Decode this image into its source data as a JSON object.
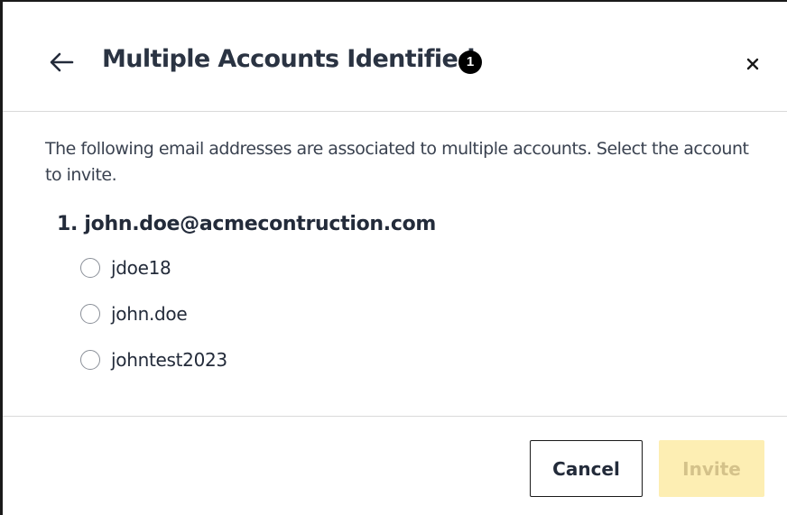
{
  "dialog": {
    "title": "Multiple Accounts Identified",
    "count_badge": "1",
    "back_icon": "arrow-left-icon",
    "close_icon": "close-icon",
    "description": "The following email addresses are associated to multiple accounts. Select the account to invite.",
    "email_heading": "1. john.doe@acmecontruction.com",
    "options": [
      {
        "label": "jdoe18",
        "selected": false
      },
      {
        "label": "john.doe",
        "selected": false
      },
      {
        "label": "johntest2023",
        "selected": false
      }
    ],
    "buttons": {
      "cancel_label": "Cancel",
      "invite_label": "Invite",
      "invite_disabled": true
    }
  },
  "colors": {
    "primary_disabled_bg": "#fdeeb3",
    "primary_disabled_text": "#d4c28a",
    "text": "#232b3a",
    "divider": "#d9d9d9"
  }
}
